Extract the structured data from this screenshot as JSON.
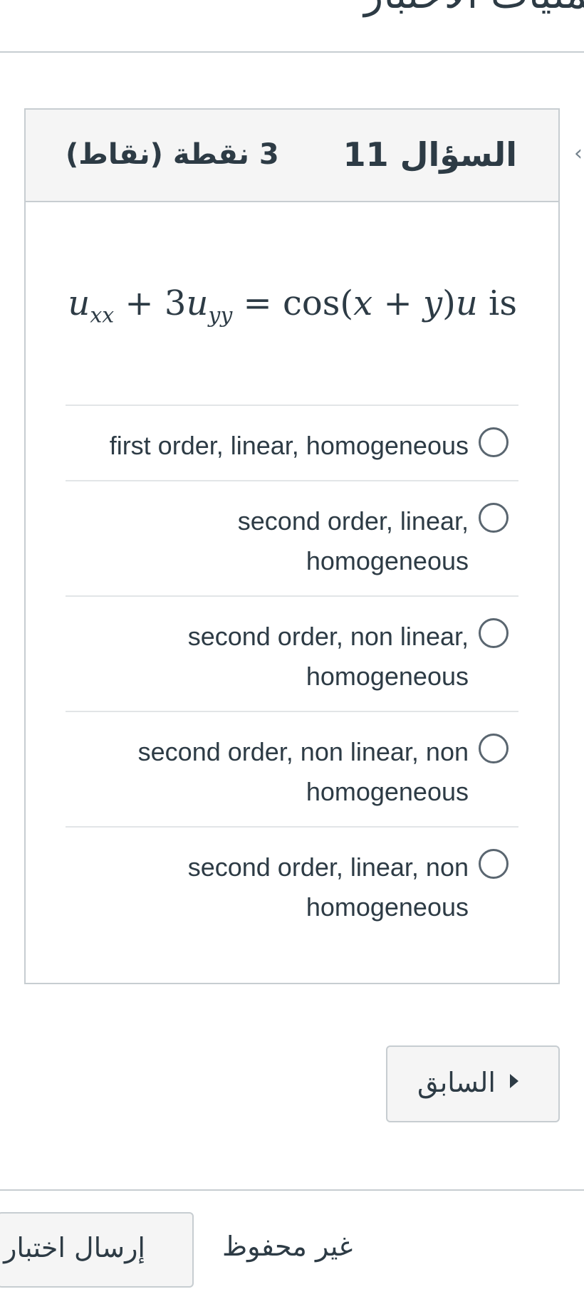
{
  "page_title": "عمليات الاختبار",
  "question": {
    "name": "السؤال 11",
    "points": "3 نقطة (نقاط)",
    "equation": {
      "u1": "u",
      "sub1": "xx",
      "plus": " + 3",
      "u2": "u",
      "sub2": "yy",
      "eq": " = cos(",
      "x": "x",
      "plus2": " + ",
      "y": "y",
      "close": ")",
      "u3": "u",
      "tail": "  is"
    },
    "answers": [
      {
        "label": "first order, linear,  homogeneous"
      },
      {
        "label": "second order, linear,\nhomogeneous"
      },
      {
        "label": "second order, non linear,\nhomogeneous"
      },
      {
        "label": "second order, non linear,  non\nhomogeneous"
      },
      {
        "label": "second order, linear,  non\nhomogeneous"
      }
    ]
  },
  "navigation": {
    "previous_label": "السابق"
  },
  "footer": {
    "status": "غير محفوظ",
    "submit_label": "إرسال اختبار"
  }
}
